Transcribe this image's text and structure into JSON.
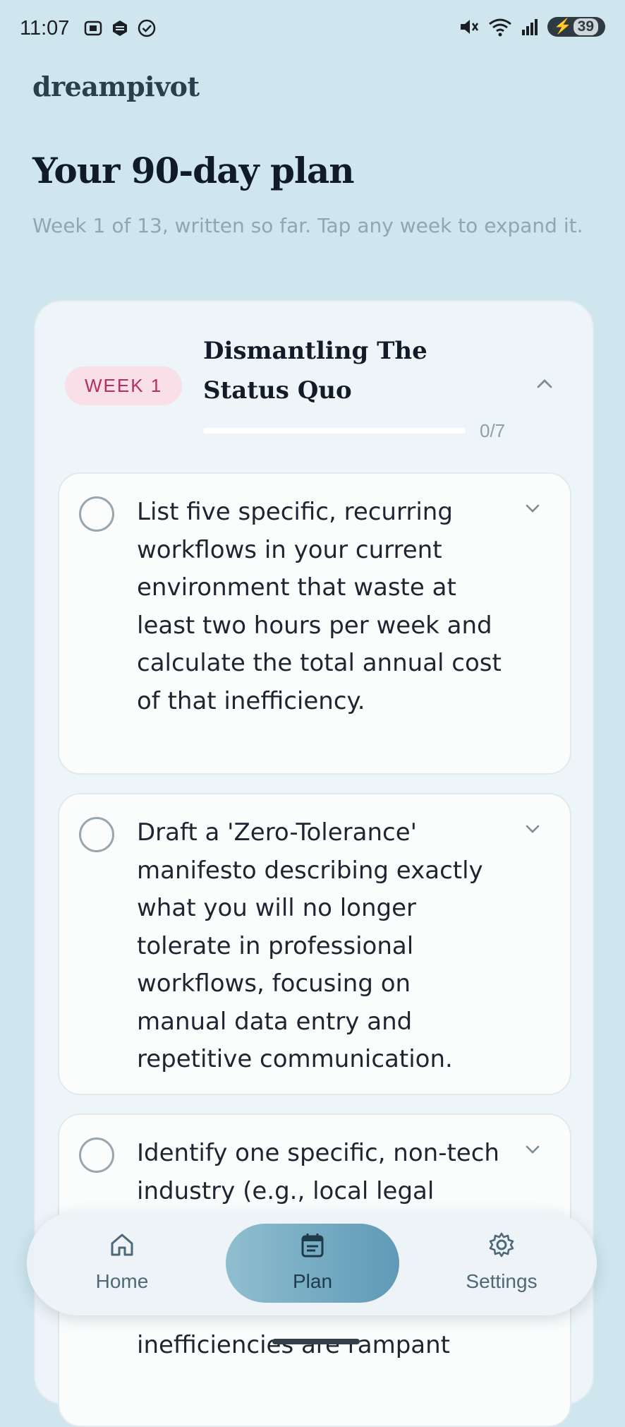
{
  "status_bar": {
    "time": "11:07",
    "battery": "39"
  },
  "brand": "dreampivot",
  "page": {
    "title": "Your 90-day plan",
    "subtitle": "Week 1 of 13, written so far. Tap any week to expand it."
  },
  "week": {
    "badge": "WEEK 1",
    "title": "Dismantling The Status Quo",
    "progress_text": "0/7",
    "progress_fraction": 0,
    "tasks": [
      {
        "text": "List five specific, recurring workflows in your current environment that waste at least two hours per week and calculate the total annual cost of that inefficiency.",
        "done": false
      },
      {
        "text": "Draft a 'Zero-Tolerance' manifesto describing exactly what you will no longer tolerate in professional workflows, focusing on manual data entry and repetitive communication.",
        "done": false
      },
      {
        "text": "Identify one specific, non-tech industry (e.g., local legal",
        "done": false
      },
      {
        "text": "inefficiencies are rampant",
        "done": false
      }
    ]
  },
  "nav": {
    "items": [
      {
        "label": "Home",
        "icon": "home-icon"
      },
      {
        "label": "Plan",
        "icon": "calendar-icon"
      },
      {
        "label": "Settings",
        "icon": "gear-icon"
      }
    ],
    "active": "Plan"
  },
  "colors": {
    "background": "#cfe6ef",
    "badge_text": "#b72e63",
    "badge_bg": "#f9dfe8",
    "active_nav": "#5f9ab7"
  }
}
